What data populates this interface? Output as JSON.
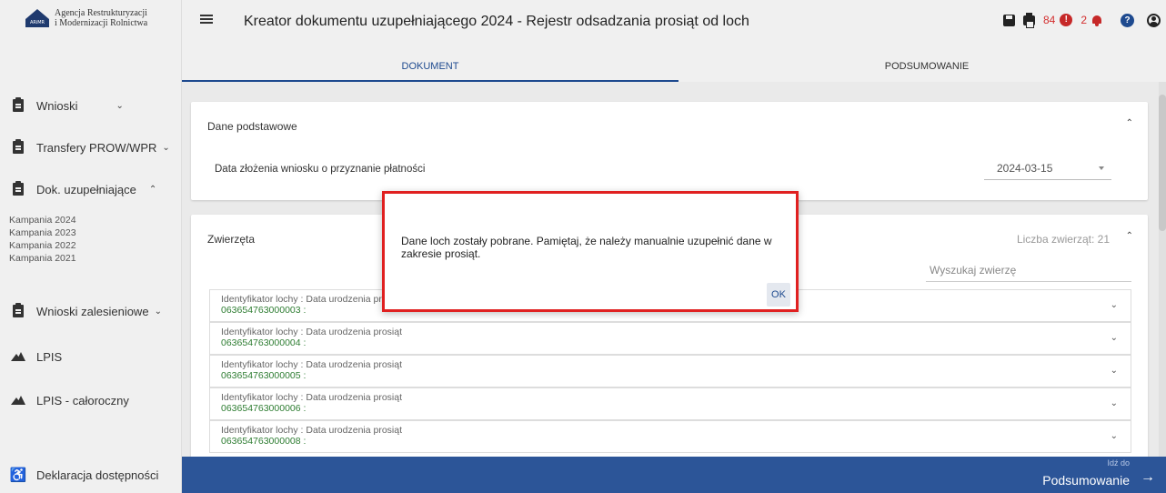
{
  "app": {
    "logo_line1": "Agencja Restrukturyzacji",
    "logo_line2": "i Modernizacji Rolnictwa",
    "logo_badge": "ARiMR",
    "title": "Kreator dokumentu uzupełniającego 2024 - Rejestr odsadzania prosiąt od loch"
  },
  "header": {
    "error_count": "84",
    "error_icon": "!",
    "notification_count": "2",
    "help_icon": "?"
  },
  "sidebar": {
    "items": [
      {
        "label": "Wnioski"
      },
      {
        "label": "Transfery PROW/WPR"
      },
      {
        "label": "Dok. uzupełniające"
      },
      {
        "label": "Wnioski zalesieniowe"
      },
      {
        "label": "LPIS"
      },
      {
        "label": "LPIS - całoroczny"
      }
    ],
    "sub_items": [
      "Kampania 2024",
      "Kampania 2023",
      "Kampania 2022",
      "Kampania 2021"
    ],
    "footer_label": "Deklaracja dostępności"
  },
  "tabs": [
    {
      "label": "DOKUMENT"
    },
    {
      "label": "PODSUMOWANIE"
    }
  ],
  "basic": {
    "title": "Dane podstawowe",
    "date_label": "Data złożenia wniosku o przyznanie płatności",
    "date_value": "2024-03-15"
  },
  "animals": {
    "title": "Zwierzęta",
    "count_text": "Liczba zwierząt: 21",
    "search_placeholder": "Wyszukaj zwierzę",
    "rows": [
      {
        "label": "Identyfikator lochy : Data urodzenia prosiąt",
        "id": "063654763000003 :"
      },
      {
        "label": "Identyfikator lochy : Data urodzenia prosiąt",
        "id": "063654763000004 :"
      },
      {
        "label": "Identyfikator lochy : Data urodzenia prosiąt",
        "id": "063654763000005 :"
      },
      {
        "label": "Identyfikator lochy : Data urodzenia prosiąt",
        "id": "063654763000006 :"
      },
      {
        "label": "Identyfikator lochy : Data urodzenia prosiąt",
        "id": "063654763000008 :"
      }
    ]
  },
  "footer": {
    "small": "Idź do",
    "big": "Podsumowanie",
    "arrow": "→"
  },
  "modal": {
    "message": "Dane loch zostały pobrane. Pamiętaj, że należy manualnie uzupełnić dane w zakresie prosiąt.",
    "ok_label": "OK"
  },
  "colors": {
    "primary": "#2c5598",
    "tab_active": "#1e4a8f",
    "error": "#c62828",
    "highlight_border": "#e02020",
    "id_green": "#2e7d32"
  }
}
